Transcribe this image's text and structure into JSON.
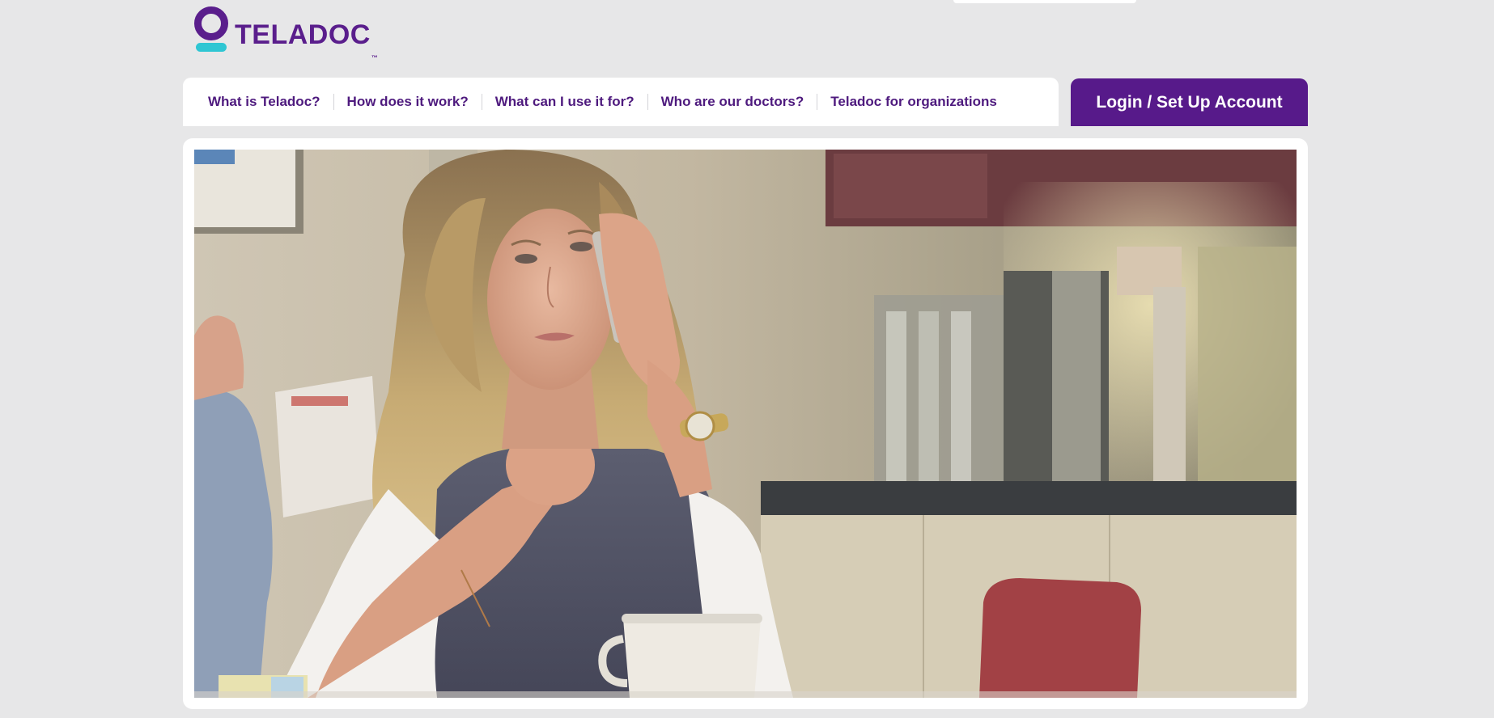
{
  "brand": {
    "name": "TELADOC",
    "trademark": "™",
    "colors": {
      "primary_purple": "#571a8a",
      "accent_teal": "#2fc6d3",
      "page_background": "#e7e7e8"
    }
  },
  "nav": {
    "items": [
      {
        "label": "What is Teladoc?"
      },
      {
        "label": "How does it work?"
      },
      {
        "label": "What can I use it for?"
      },
      {
        "label": "Who are our doctors?"
      },
      {
        "label": "Teladoc for organizations"
      }
    ]
  },
  "login": {
    "label": "Login / Set Up Account"
  },
  "hero": {
    "image_icon": "photo-of-woman-on-phone-icon"
  }
}
